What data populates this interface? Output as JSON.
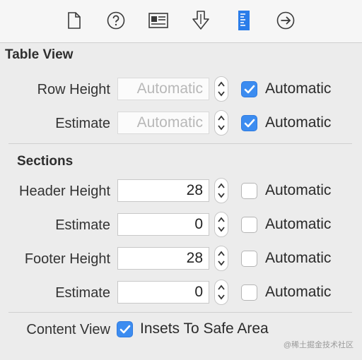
{
  "toolbar": {
    "icons": [
      "file-inspector-icon",
      "help-icon",
      "identity-inspector-icon",
      "attributes-inspector-icon",
      "size-inspector-icon",
      "connections-inspector-icon"
    ]
  },
  "table_view": {
    "title": "Table View",
    "row_height": {
      "label": "Row Height",
      "value": "Automatic",
      "auto_label": "Automatic",
      "auto_checked": true
    },
    "estimate": {
      "label": "Estimate",
      "value": "Automatic",
      "auto_label": "Automatic",
      "auto_checked": true
    }
  },
  "sections": {
    "title": "Sections",
    "header_height": {
      "label": "Header Height",
      "value": "28",
      "auto_label": "Automatic",
      "auto_checked": false
    },
    "header_estimate": {
      "label": "Estimate",
      "value": "0",
      "auto_label": "Automatic",
      "auto_checked": false
    },
    "footer_height": {
      "label": "Footer Height",
      "value": "28",
      "auto_label": "Automatic",
      "auto_checked": false
    },
    "footer_estimate": {
      "label": "Estimate",
      "value": "0",
      "auto_label": "Automatic",
      "auto_checked": false
    }
  },
  "content_view": {
    "label": "Content View",
    "insets_label": "Insets To Safe Area",
    "insets_checked": true
  },
  "watermark": "@稀土掘金技术社区",
  "colors": {
    "accent": "#3c8cf0",
    "active_icon": "#2b7de9",
    "icon": "#3a3a3a"
  }
}
